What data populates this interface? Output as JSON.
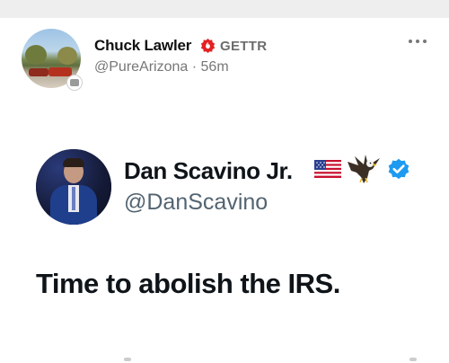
{
  "post": {
    "author": {
      "display_name": "Chuck Lawler",
      "platform_badge": "GETTR",
      "handle": "@PureArizona",
      "separator": "·",
      "timestamp": "56m"
    },
    "menu_icon": "more-horizontal-icon"
  },
  "embedded_tweet": {
    "author": {
      "display_name": "Dan Scavino Jr.",
      "handle": "@DanScavino",
      "emoji": [
        "us-flag-icon",
        "eagle-icon"
      ],
      "verified": true
    },
    "text": "Time to abolish the IRS."
  },
  "colors": {
    "gettr_red": "#e42121",
    "verified_blue": "#1d9bf0",
    "muted_text": "#777777",
    "tweet_text": "#0f1419"
  }
}
